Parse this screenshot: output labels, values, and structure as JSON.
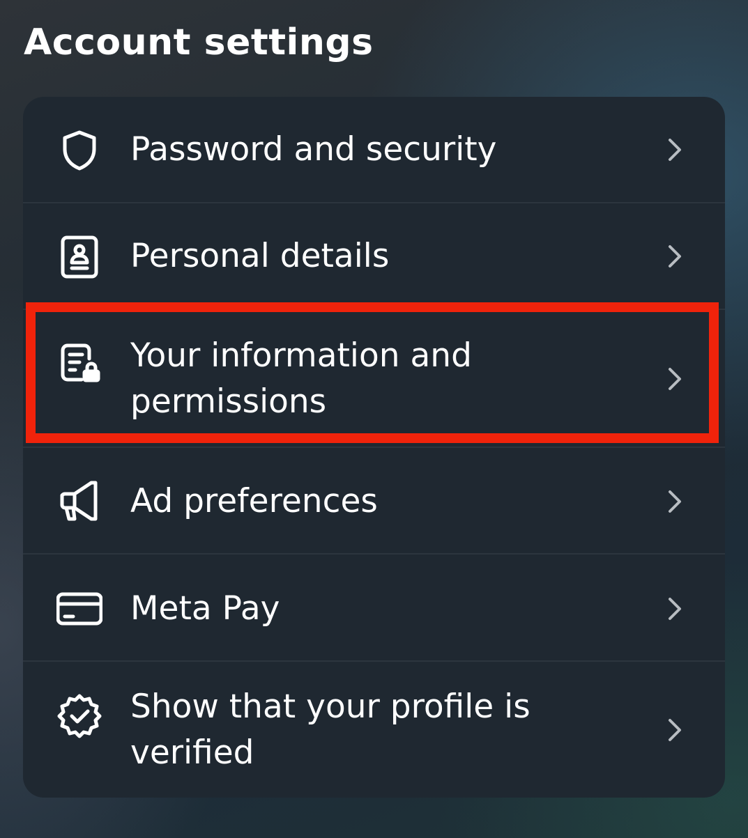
{
  "header": {
    "title": "Account settings"
  },
  "menu": {
    "items": [
      {
        "label": "Password and security",
        "icon": "shield-icon"
      },
      {
        "label": "Personal details",
        "icon": "id-card-icon"
      },
      {
        "label": "Your information and permissions",
        "icon": "document-lock-icon",
        "highlighted": true
      },
      {
        "label": "Ad preferences",
        "icon": "megaphone-icon"
      },
      {
        "label": "Meta Pay",
        "icon": "credit-card-icon"
      },
      {
        "label": "Show that your profile is verified",
        "icon": "verified-badge-icon"
      }
    ]
  },
  "colors": {
    "card_background": "#1f2831",
    "divider": "#2c353e",
    "text": "#ffffff",
    "chevron": "#b8bdc2",
    "highlight_border": "#f0230b"
  }
}
